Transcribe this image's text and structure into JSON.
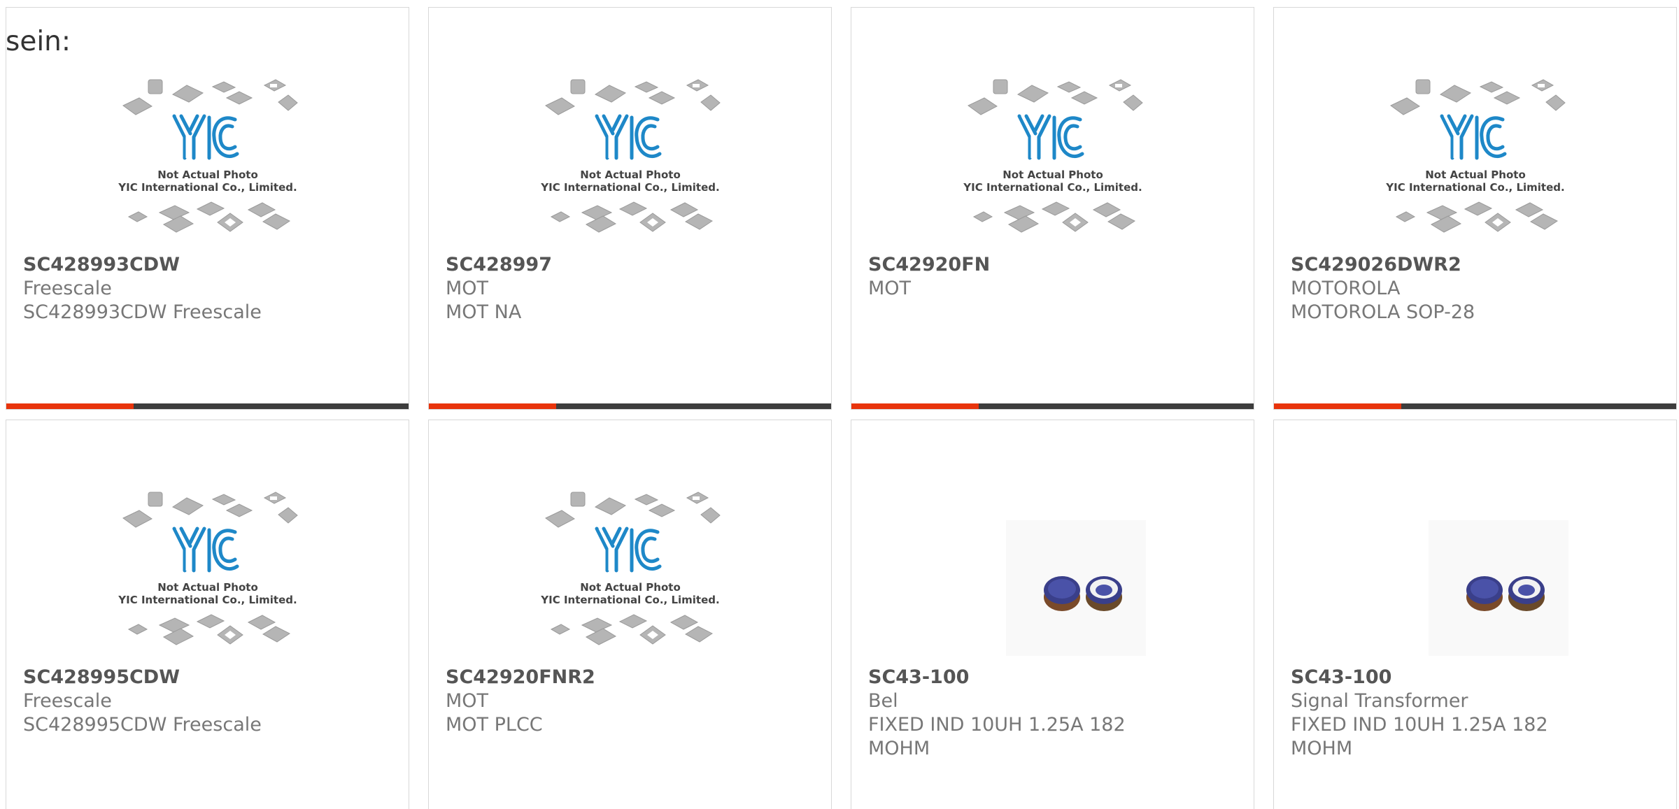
{
  "intro_text": "sein:",
  "placeholder": {
    "line1": "Not Actual Photo",
    "line2": "YIC International Co., Limited."
  },
  "colors": {
    "accent": "#e8340c",
    "bar": "#3d3d3d",
    "logo_blue": "#1e88c8",
    "chip_gray": "#b5b5b5"
  },
  "products": [
    {
      "part": "SC428993CDW",
      "manufacturer": "Freescale",
      "description": "SC428993CDW Freescale",
      "image": "placeholder"
    },
    {
      "part": "SC428997",
      "manufacturer": "MOT",
      "description": "MOT NA",
      "image": "placeholder"
    },
    {
      "part": "SC42920FN",
      "manufacturer": "MOT",
      "description": "",
      "image": "placeholder"
    },
    {
      "part": "SC429026DWR2",
      "manufacturer": "MOTOROLA",
      "description": "MOTOROLA SOP-28",
      "image": "placeholder"
    },
    {
      "part": "SC428995CDW",
      "manufacturer": "Freescale",
      "description": "SC428995CDW Freescale",
      "image": "placeholder"
    },
    {
      "part": "SC42920FNR2",
      "manufacturer": "MOT",
      "description": "MOT PLCC",
      "image": "placeholder"
    },
    {
      "part": "SC43-100",
      "manufacturer": "Bel",
      "description": "FIXED IND 10UH 1.25A 182 MOHM",
      "image": "inductor"
    },
    {
      "part": "SC43-100",
      "manufacturer": "Signal Transformer",
      "description": "FIXED IND 10UH 1.25A 182 MOHM",
      "image": "inductor"
    }
  ]
}
